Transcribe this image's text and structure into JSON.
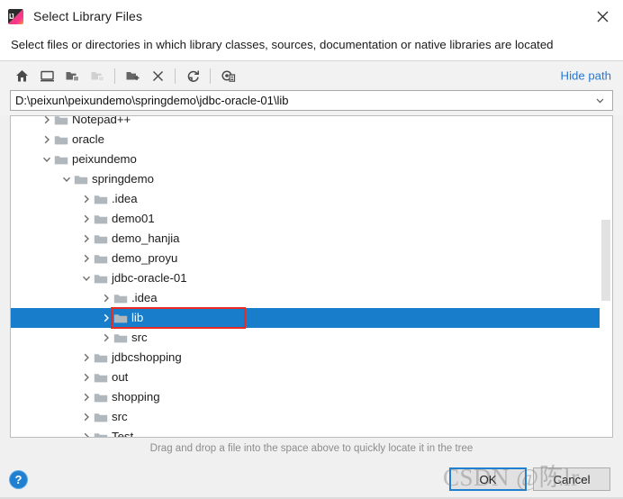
{
  "window": {
    "title": "Select Library Files",
    "app_icon": "intellij-idea-icon",
    "close_label": "✕"
  },
  "subtitle": "Select files or directories in which library classes, sources, documentation or native libraries are located",
  "toolbar": {
    "buttons": [
      {
        "name": "home-icon",
        "tooltip": "Home",
        "disabled": false
      },
      {
        "name": "desktop-icon",
        "tooltip": "Desktop",
        "disabled": false
      },
      {
        "name": "folder-up-icon",
        "tooltip": "Up",
        "disabled": false
      },
      {
        "name": "folder-up-disabled-icon",
        "tooltip": "Up",
        "disabled": true
      },
      {
        "name": "new-folder-icon",
        "tooltip": "New Folder",
        "disabled": false
      },
      {
        "name": "delete-icon",
        "tooltip": "Delete",
        "disabled": false
      },
      {
        "name": "refresh-icon",
        "tooltip": "Refresh",
        "disabled": false
      },
      {
        "name": "show-hidden-files-icon",
        "tooltip": "Show Hidden Files",
        "disabled": false
      }
    ],
    "hide_path_label": "Hide path"
  },
  "path_field": {
    "value": "D:\\peixun\\peixundemo\\springdemo\\jdbc-oracle-01\\lib",
    "placeholder": "",
    "dropdown_icon": "chevron-down-icon"
  },
  "tree": {
    "rows": [
      {
        "label": "Notepad++",
        "depth": 1,
        "expander": "collapsed",
        "selected": false
      },
      {
        "label": "oracle",
        "depth": 1,
        "expander": "collapsed",
        "selected": false
      },
      {
        "label": "peixundemo",
        "depth": 1,
        "expander": "expanded",
        "selected": false
      },
      {
        "label": "springdemo",
        "depth": 2,
        "expander": "expanded",
        "selected": false
      },
      {
        "label": ".idea",
        "depth": 3,
        "expander": "collapsed",
        "selected": false
      },
      {
        "label": "demo01",
        "depth": 3,
        "expander": "collapsed",
        "selected": false
      },
      {
        "label": "demo_hanjia",
        "depth": 3,
        "expander": "collapsed",
        "selected": false
      },
      {
        "label": "demo_proyu",
        "depth": 3,
        "expander": "collapsed",
        "selected": false
      },
      {
        "label": "jdbc-oracle-01",
        "depth": 3,
        "expander": "expanded",
        "selected": false
      },
      {
        "label": ".idea",
        "depth": 4,
        "expander": "collapsed",
        "selected": false
      },
      {
        "label": "lib",
        "depth": 4,
        "expander": "collapsed",
        "selected": true
      },
      {
        "label": "src",
        "depth": 4,
        "expander": "collapsed",
        "selected": false
      },
      {
        "label": "jdbcshopping",
        "depth": 3,
        "expander": "collapsed",
        "selected": false
      },
      {
        "label": "out",
        "depth": 3,
        "expander": "collapsed",
        "selected": false
      },
      {
        "label": "shopping",
        "depth": 3,
        "expander": "collapsed",
        "selected": false
      },
      {
        "label": "src",
        "depth": 3,
        "expander": "collapsed",
        "selected": false
      },
      {
        "label": "Test",
        "depth": 3,
        "expander": "collapsed",
        "selected": false
      }
    ],
    "selection_color": "#187dcb",
    "annotation_color": "#e82b20"
  },
  "hint": "Drag and drop a file into the space above to quickly locate it in the tree",
  "footer": {
    "help_label": "?",
    "ok_label": "OK",
    "cancel_label": "Cancel"
  },
  "watermark": "CSDN @陈lr",
  "colors": {
    "accent": "#187dcb",
    "link": "#2879d0",
    "annotation": "#e82b20",
    "folder": "#b0b7bd"
  }
}
